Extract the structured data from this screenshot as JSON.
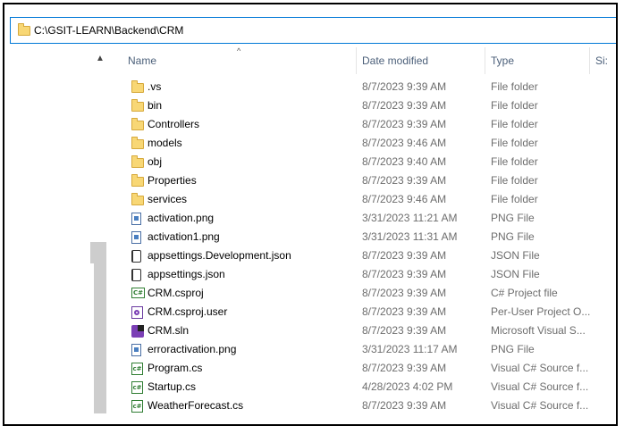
{
  "address": {
    "path": "C:\\GSIT-LEARN\\Backend\\CRM"
  },
  "columns": {
    "name": "Name",
    "date": "Date modified",
    "type": "Type",
    "size": "Si:"
  },
  "files": [
    {
      "icon": "folder-icon",
      "name": ".vs",
      "date": "8/7/2023 9:39 AM",
      "type": "File folder"
    },
    {
      "icon": "folder-icon",
      "name": "bin",
      "date": "8/7/2023 9:39 AM",
      "type": "File folder"
    },
    {
      "icon": "folder-icon",
      "name": "Controllers",
      "date": "8/7/2023 9:39 AM",
      "type": "File folder"
    },
    {
      "icon": "folder-icon",
      "name": "models",
      "date": "8/7/2023 9:46 AM",
      "type": "File folder"
    },
    {
      "icon": "folder-icon",
      "name": "obj",
      "date": "8/7/2023 9:40 AM",
      "type": "File folder"
    },
    {
      "icon": "folder-icon",
      "name": "Properties",
      "date": "8/7/2023 9:39 AM",
      "type": "File folder"
    },
    {
      "icon": "folder-icon",
      "name": "services",
      "date": "8/7/2023 9:46 AM",
      "type": "File folder"
    },
    {
      "icon": "image-file-icon",
      "name": "activation.png",
      "date": "3/31/2023 11:21 AM",
      "type": "PNG File"
    },
    {
      "icon": "image-file-icon",
      "name": "activation1.png",
      "date": "3/31/2023 11:31 AM",
      "type": "PNG File"
    },
    {
      "icon": "json-file-icon",
      "name": "appsettings.Development.json",
      "date": "8/7/2023 9:39 AM",
      "type": "JSON File"
    },
    {
      "icon": "json-file-icon",
      "name": "appsettings.json",
      "date": "8/7/2023 9:39 AM",
      "type": "JSON File"
    },
    {
      "icon": "csproj-file-icon",
      "name": "CRM.csproj",
      "date": "8/7/2023 9:39 AM",
      "type": "C# Project file"
    },
    {
      "icon": "user-file-icon",
      "name": "CRM.csproj.user",
      "date": "8/7/2023 9:39 AM",
      "type": "Per-User Project O..."
    },
    {
      "icon": "solution-file-icon",
      "name": "CRM.sln",
      "date": "8/7/2023 9:39 AM",
      "type": "Microsoft Visual S..."
    },
    {
      "icon": "image-file-icon",
      "name": "erroractivation.png",
      "date": "3/31/2023 11:17 AM",
      "type": "PNG File"
    },
    {
      "icon": "csharp-file-icon",
      "name": "Program.cs",
      "date": "8/7/2023 9:39 AM",
      "type": "Visual C# Source f..."
    },
    {
      "icon": "csharp-file-icon",
      "name": "Startup.cs",
      "date": "4/28/2023 4:02 PM",
      "type": "Visual C# Source f..."
    },
    {
      "icon": "csharp-file-icon",
      "name": "WeatherForecast.cs",
      "date": "8/7/2023 9:39 AM",
      "type": "Visual C# Source f..."
    }
  ],
  "icon_labels": {
    "csproj": "C#",
    "csharp": "c#"
  }
}
